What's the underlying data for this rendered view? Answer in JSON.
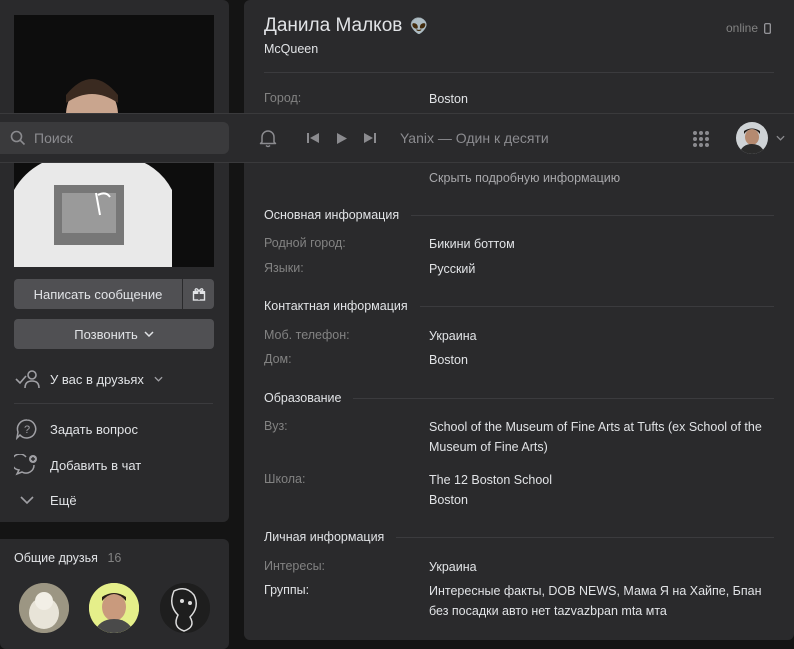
{
  "profile": {
    "name": "Данила Малков",
    "emoji": "👽",
    "status_line": "McQueen",
    "online": "online"
  },
  "left": {
    "write_message": "Написать сообщение",
    "call": "Позвонить",
    "friends_state": "У вас в друзьях",
    "ask_question": "Задать вопрос",
    "add_to_chat": "Добавить в чат",
    "more": "Ещё",
    "common_friends": "Общие друзья",
    "common_friends_count": "16"
  },
  "topbar": {
    "search_placeholder": "Поиск",
    "track": "Yanix — Один к десяти"
  },
  "info": {
    "city_label": "Город:",
    "city_value": "Boston",
    "hide_details": "Скрыть подробную информацию",
    "sections": {
      "basic": "Основная информация",
      "contacts": "Контактная информация",
      "education": "Образование",
      "personal": "Личная информация"
    },
    "hometown_label": "Родной город:",
    "hometown_value": "Бикини боттом",
    "languages_label": "Языки:",
    "languages_value": "Русский",
    "mobile_label": "Моб. телефон:",
    "mobile_value": "Украина",
    "home_label": "Дом:",
    "home_value": "Boston",
    "university_label": "Вуз:",
    "university_value": "School of the Museum of Fine Arts at Tufts (ex School of the Museum of Fine Arts)",
    "school_label": "Школа:",
    "school_name": "The 12 Boston School",
    "school_city": "Boston",
    "interests_label": "Интересы:",
    "interests_value": "Украина",
    "groups_label": "Группы:",
    "groups_value": "Интересные факты, DOB NEWS, Мама Я на Хайпе, Бпан без посадки авто нет tazvazbpan mta мта"
  },
  "colors": {
    "background": "#141414",
    "card": "#2a2a2c",
    "button": "#505053",
    "muted_text": "#828282"
  }
}
